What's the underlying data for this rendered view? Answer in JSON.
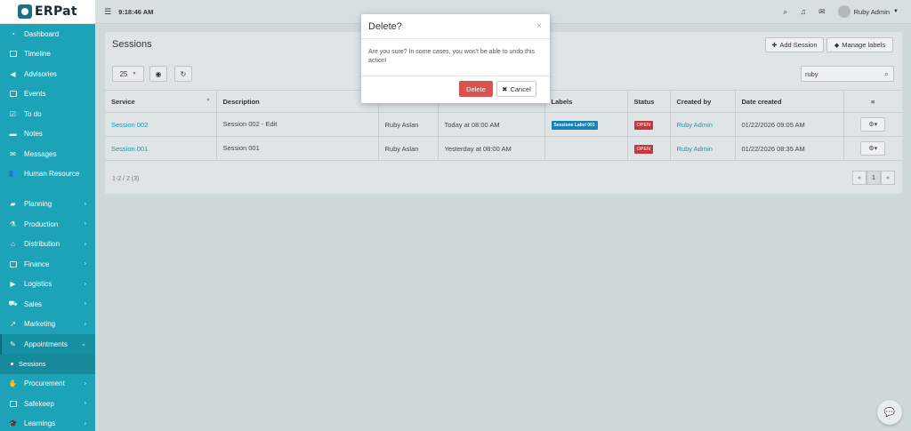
{
  "brand": {
    "logo_text": "ERPat"
  },
  "topbar": {
    "time": "9:18:46 AM",
    "user_name": "Ruby Admin"
  },
  "sidebar": {
    "items": [
      {
        "label": "Dashboard",
        "icon": "dashboard-icon"
      },
      {
        "label": "Timeline",
        "icon": "timeline-icon"
      },
      {
        "label": "Advisories",
        "icon": "megaphone-icon"
      },
      {
        "label": "Events",
        "icon": "calendar-icon"
      },
      {
        "label": "To do",
        "icon": "checkbox-icon"
      },
      {
        "label": "Notes",
        "icon": "notes-icon"
      },
      {
        "label": "Messages",
        "icon": "envelope-icon"
      },
      {
        "label": "Human Resource",
        "icon": "users-icon"
      },
      {
        "label": "Planning",
        "icon": "briefcase-icon"
      },
      {
        "label": "Production",
        "icon": "flask-icon"
      },
      {
        "label": "Distribution",
        "icon": "bank-icon"
      },
      {
        "label": "Finance",
        "icon": "money-icon"
      },
      {
        "label": "Logistics",
        "icon": "truck-icon"
      },
      {
        "label": "Sales",
        "icon": "cart-icon"
      },
      {
        "label": "Marketing",
        "icon": "chart-icon"
      },
      {
        "label": "Appointments",
        "icon": "edit-icon"
      },
      {
        "label": "Sessions",
        "icon": "dot-icon"
      },
      {
        "label": "Procurement",
        "icon": "handshake-icon"
      },
      {
        "label": "Safekeep",
        "icon": "archive-icon"
      },
      {
        "label": "Learnings",
        "icon": "graduation-icon"
      }
    ]
  },
  "page": {
    "title": "Sessions",
    "add_button": "Add Session",
    "labels_button": "Manage labels",
    "page_size": "25",
    "search_value": "ruby",
    "count_text": "1-2 / 2 (3)",
    "current_page": "1"
  },
  "table": {
    "headers": [
      "Service",
      "Description",
      "",
      "",
      "Labels",
      "Status",
      "Created by",
      "Date created",
      "≡"
    ],
    "rows": [
      {
        "service": "Session 002",
        "description": "Session 002 - Edit",
        "client": "Ruby Aslan",
        "schedule": "Today at 08:00 AM",
        "label": "Sessions Label 001",
        "status": "OPEN",
        "created_by": "Ruby Admin",
        "date_created": "01/22/2026 09:05 AM"
      },
      {
        "service": "Session 001",
        "description": "Session 001",
        "client": "Ruby Aslan",
        "schedule": "Yesterday at 08:00 AM",
        "label": "",
        "status": "OPEN",
        "created_by": "Ruby Admin",
        "date_created": "01/22/2026 08:35 AM"
      }
    ]
  },
  "modal": {
    "title": "Delete?",
    "message": "Are you sure? In some cases, you won't be able to undo this action!",
    "delete_label": "Delete",
    "cancel_label": "Cancel"
  },
  "colors": {
    "sidebar": "#1da3b8",
    "danger": "#d9534f",
    "link": "#1d95ad",
    "label_badge": "#1b7fb8"
  }
}
